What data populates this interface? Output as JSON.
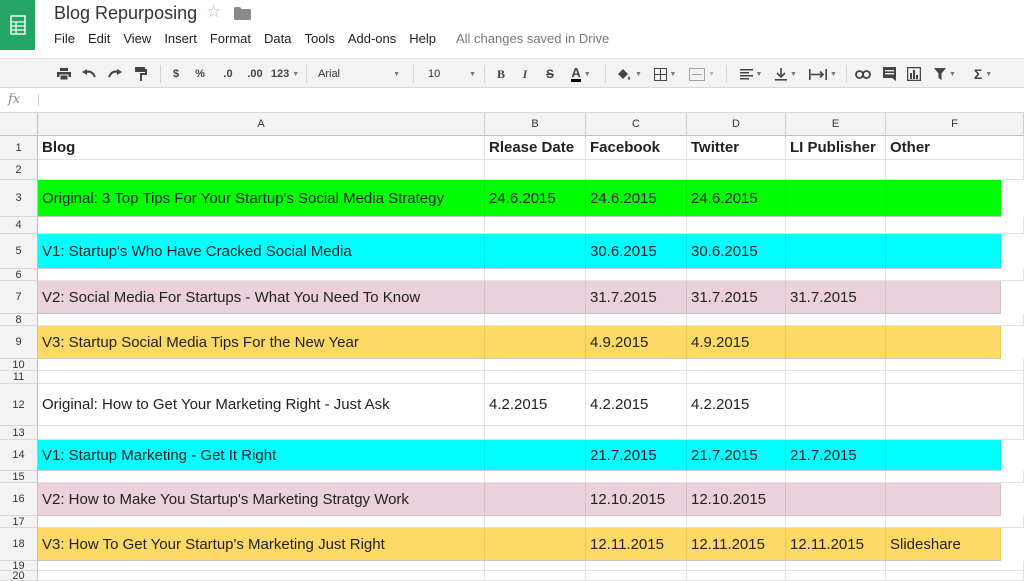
{
  "document": {
    "title": "Blog Repurposing",
    "save_status": "All changes saved in Drive"
  },
  "menu": [
    "File",
    "Edit",
    "View",
    "Insert",
    "Format",
    "Data",
    "Tools",
    "Add-ons",
    "Help"
  ],
  "toolbar": {
    "currency": "$",
    "percent": "%",
    "decrease_decimals": ".0",
    "increase_decimals": ".00",
    "more_formats": "123",
    "font_family": "Arial",
    "font_size": "10",
    "bold": "B",
    "italic": "I",
    "strikethrough": "S",
    "text_color": "A",
    "function": "Σ"
  },
  "formula_bar": {
    "fx_label": "fx",
    "value": ""
  },
  "columns": [
    "A",
    "B",
    "C",
    "D",
    "E",
    "F"
  ],
  "row_numbers": [
    "1",
    "2",
    "3",
    "4",
    "5",
    "6",
    "7",
    "8",
    "9",
    "10",
    "11",
    "12",
    "13",
    "14",
    "15",
    "16",
    "17",
    "18",
    "19",
    "20"
  ],
  "colors": {
    "green": "#00ff00",
    "cyan": "#00ffff",
    "pink": "#ead1dc",
    "yellow": "#ffd966",
    "brand": "#23a566"
  },
  "rows": [
    {
      "fill": "",
      "bold": true,
      "cells": [
        "Blog",
        "Rlease Date",
        "Facebook",
        "Twitter",
        "LI Publisher",
        "Other"
      ]
    },
    {
      "fill": "",
      "bold": false,
      "cells": [
        "",
        "",
        "",
        "",
        "",
        ""
      ]
    },
    {
      "fill": "green",
      "bold": false,
      "cells": [
        " Original: 3 Top Tips For Your Startup's Social Media Strategy",
        "24.6.2015",
        "24.6.2015",
        "24.6.2015",
        "",
        ""
      ]
    },
    {
      "fill": "",
      "bold": false,
      "cells": [
        "",
        "",
        "",
        "",
        "",
        ""
      ]
    },
    {
      "fill": "cyan",
      "bold": false,
      "cells": [
        "V1: Startup's Who Have Cracked Social Media",
        "",
        "30.6.2015",
        "30.6.2015",
        "",
        ""
      ]
    },
    {
      "fill": "",
      "bold": false,
      "cells": [
        "",
        "",
        "",
        "",
        "",
        ""
      ]
    },
    {
      "fill": "pink",
      "bold": false,
      "cells": [
        "V2: Social Media For Startups - What You Need To Know",
        "",
        "31.7.2015",
        "31.7.2015",
        "31.7.2015",
        ""
      ]
    },
    {
      "fill": "",
      "bold": false,
      "cells": [
        "",
        "",
        "",
        "",
        "",
        ""
      ]
    },
    {
      "fill": "yellow",
      "bold": false,
      "cells": [
        "V3: Startup Social Media Tips For the New Year",
        "",
        "4.9.2015",
        "4.9.2015",
        "",
        ""
      ]
    },
    {
      "fill": "",
      "bold": false,
      "cells": [
        "",
        "",
        "",
        "",
        "",
        ""
      ]
    },
    {
      "fill": "",
      "bold": false,
      "cells": [
        "",
        "",
        "",
        "",
        "",
        ""
      ]
    },
    {
      "fill": "",
      "bold": false,
      "cells": [
        "Original: How to Get Your Marketing Right - Just Ask",
        "4.2.2015",
        "4.2.2015",
        "4.2.2015",
        "",
        ""
      ]
    },
    {
      "fill": "",
      "bold": false,
      "cells": [
        "",
        "",
        "",
        "",
        "",
        ""
      ]
    },
    {
      "fill": "cyan",
      "bold": false,
      "cells": [
        "V1: Startup Marketing - Get It Right",
        "",
        "21.7.2015",
        "21.7.2015",
        "21.7.2015",
        ""
      ]
    },
    {
      "fill": "",
      "bold": false,
      "cells": [
        "",
        "",
        "",
        "",
        "",
        ""
      ]
    },
    {
      "fill": "pink",
      "bold": false,
      "cells": [
        "V2: How to Make You Startup's Marketing Stratgy Work",
        "",
        "12.10.2015",
        "12.10.2015",
        "",
        ""
      ]
    },
    {
      "fill": "",
      "bold": false,
      "cells": [
        "",
        "",
        "",
        "",
        "",
        ""
      ]
    },
    {
      "fill": "yellow",
      "bold": false,
      "cells": [
        "V3: How To Get Your Startup's Marketing Just Right",
        "",
        "12.11.2015",
        "12.11.2015",
        "12.11.2015",
        "Slideshare"
      ]
    },
    {
      "fill": "",
      "bold": false,
      "cells": [
        "",
        "",
        "",
        "",
        "",
        ""
      ]
    },
    {
      "fill": "",
      "bold": false,
      "cells": [
        "",
        "",
        "",
        "",
        "",
        ""
      ]
    }
  ]
}
